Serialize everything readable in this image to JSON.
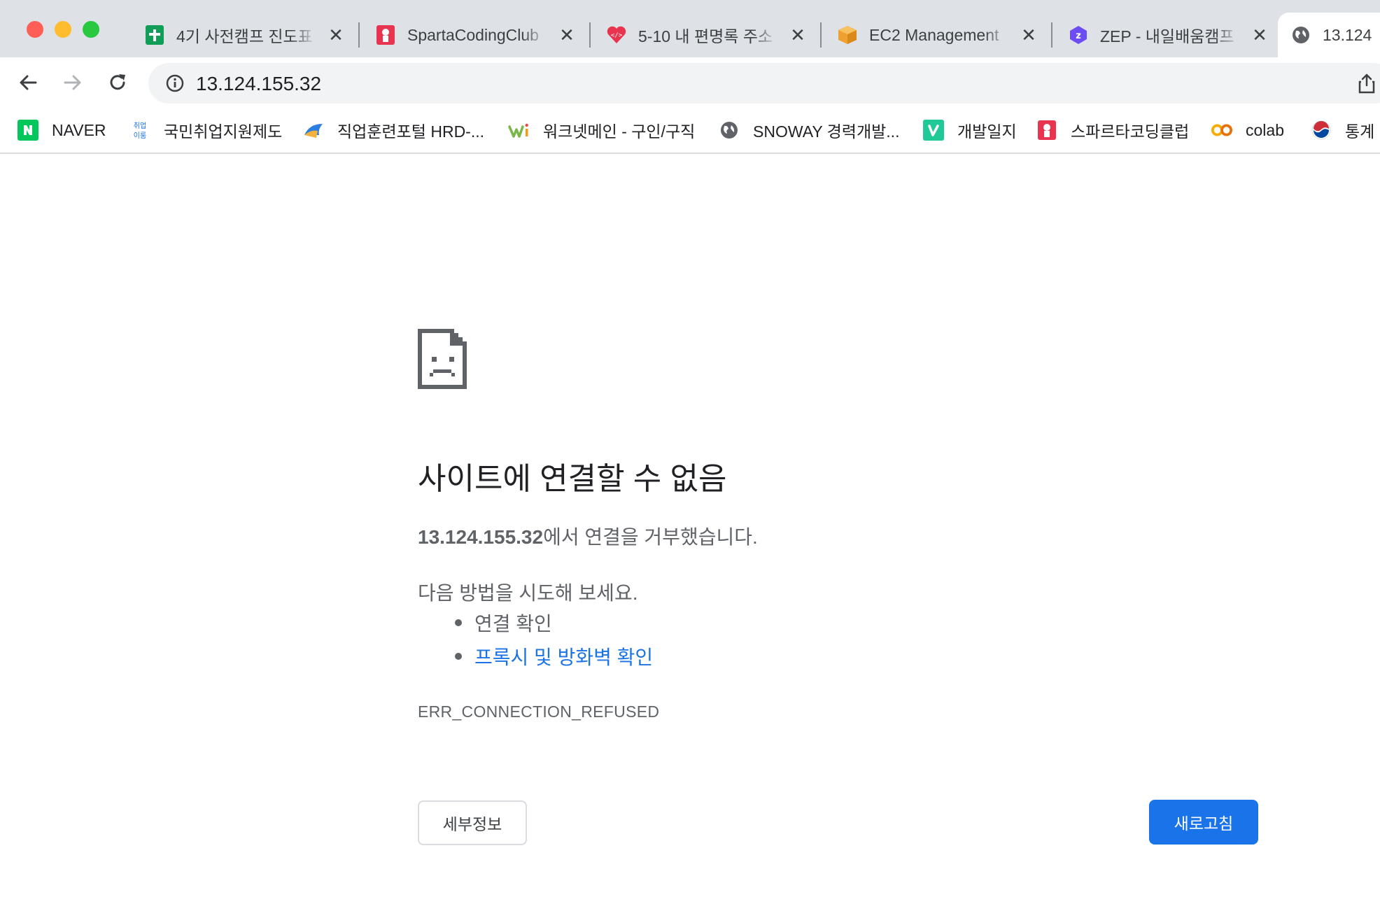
{
  "window": {
    "controls": [
      "close",
      "minimize",
      "maximize"
    ],
    "colors": {
      "close": "#ff5f57",
      "minimize": "#febc2e",
      "maximize": "#28c840"
    }
  },
  "tabs": [
    {
      "title": "4기 사전캠프 진도표",
      "icon": "google-sheets-icon",
      "active": false
    },
    {
      "title": "SpartaCodingClub",
      "icon": "sparta-icon",
      "active": false
    },
    {
      "title": "5-10 내 편명록 주소",
      "icon": "code-heart-icon",
      "active": false
    },
    {
      "title": "EC2 Management",
      "icon": "aws-box-icon",
      "active": false
    },
    {
      "title": "ZEP - 내일배움캠프",
      "icon": "zep-icon",
      "active": false
    },
    {
      "title": "13.124",
      "icon": "globe-icon",
      "active": true
    }
  ],
  "toolbar": {
    "back_icon": "back-arrow-icon",
    "forward_icon": "forward-arrow-icon",
    "reload_icon": "reload-icon",
    "url": "13.124.155.32",
    "share_icon": "share-icon"
  },
  "bookmarks": [
    {
      "label": "NAVER",
      "icon": "naver-icon"
    },
    {
      "label": "국민취업지원제도",
      "icon": "employment-icon"
    },
    {
      "label": "직업훈련포털 HRD-...",
      "icon": "hrd-icon"
    },
    {
      "label": "워크넷메인 - 구인/구직",
      "icon": "worknet-icon"
    },
    {
      "label": "SNOWAY 경력개발...",
      "icon": "globe-icon"
    },
    {
      "label": "개발일지",
      "icon": "velog-icon"
    },
    {
      "label": "스파르타코딩클럽",
      "icon": "sparta-icon"
    },
    {
      "label": "colab",
      "icon": "colab-icon"
    },
    {
      "label": "통계",
      "icon": "korea-gov-icon"
    }
  ],
  "error": {
    "icon": "sad-page-icon",
    "title": "사이트에 연결할 수 없음",
    "host": "13.124.155.32",
    "message_suffix": "에서 연결을 거부했습니다.",
    "suggestion_heading": "다음 방법을 시도해 보세요.",
    "suggestions": [
      {
        "label": "연결 확인",
        "link": false
      },
      {
        "label": "프록시 및 방화벽 확인",
        "link": true
      }
    ],
    "code": "ERR_CONNECTION_REFUSED",
    "details_button": "세부정보",
    "reload_button": "새로고침"
  },
  "colors": {
    "accent": "#1a73e8",
    "link": "#1a73e8",
    "text": "#202124",
    "secondary": "#5f6368"
  }
}
